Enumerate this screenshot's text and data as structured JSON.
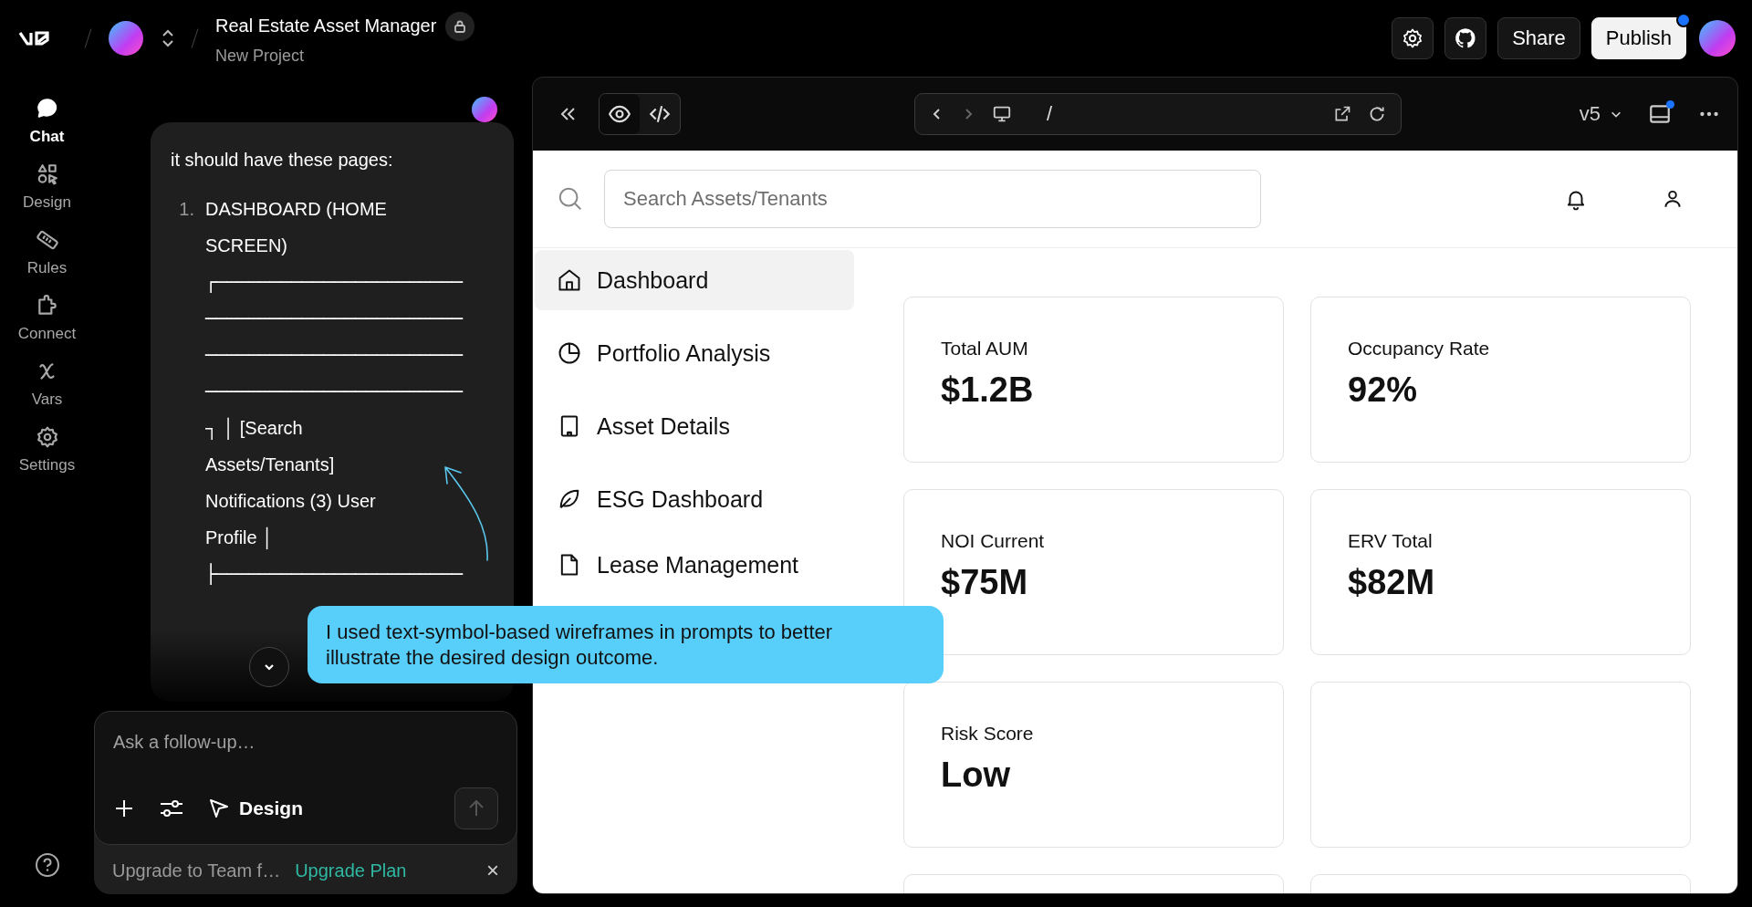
{
  "header": {
    "project_title": "Real Estate Asset Manager",
    "project_subtitle": "New Project",
    "buttons": [
      {
        "label": "Share",
        "kind": "secondary",
        "dot": false
      },
      {
        "label": "Publish",
        "kind": "primary",
        "dot": true
      }
    ]
  },
  "rail": {
    "items": [
      {
        "label": "Chat",
        "selected": true
      },
      {
        "label": "Design",
        "selected": false
      },
      {
        "label": "Rules",
        "selected": false
      },
      {
        "label": "Connect",
        "selected": false
      },
      {
        "label": "Vars",
        "selected": false
      },
      {
        "label": "Settings",
        "selected": false
      }
    ]
  },
  "chat": {
    "message": {
      "intro": "it should have these pages:",
      "items": [
        {
          "number": "1.",
          "title": "DASHBOARD (HOME SCREEN)",
          "wireframe_lines": [
            "┌───────────────────────",
            "────────────────────────",
            "────────────────────────",
            "────────────────────────",
            "┐ │ [Search",
            "Assets/Tenants]",
            "Notifications (3) User",
            "Profile │",
            "├───────────────────────"
          ]
        }
      ]
    },
    "input": {
      "placeholder": "Ask a follow-up…",
      "mode": "Design"
    },
    "upgrade": {
      "text": "Upgrade to Team f…",
      "link": "Upgrade Plan",
      "close": "×"
    }
  },
  "preview": {
    "view_tabs": [
      {
        "selected": true
      },
      {
        "selected": false
      }
    ],
    "address": "/",
    "version": "v5",
    "panel_dot": true,
    "search": {
      "placeholder": "Search Assets/Tenants"
    },
    "nav": [
      {
        "label": "Dashboard",
        "selected": true
      },
      {
        "label": "Portfolio Analysis",
        "selected": false
      },
      {
        "label": "Asset Details",
        "selected": false
      },
      {
        "label": "ESG Dashboard",
        "selected": false
      },
      {
        "label": "Lease Management",
        "selected": false
      }
    ],
    "cards": [
      {
        "label": "Total AUM",
        "value": "$1.2B"
      },
      {
        "label": "Occupancy Rate",
        "value": "92%"
      },
      {
        "label": "NOI Current",
        "value": "$75M"
      },
      {
        "label": "ERV Total",
        "value": "$82M"
      },
      {
        "label": "Risk Score",
        "value": "Low"
      }
    ]
  },
  "callout": {
    "text": "I used text-symbol-based wireframes in prompts to better illustrate the desired design outcome."
  }
}
